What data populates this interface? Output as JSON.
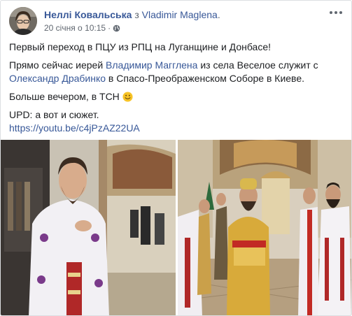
{
  "post": {
    "author": "Неллі Ковальська",
    "with_word": " з ",
    "tagged": "Vladimir Maglena",
    "tagged_suffix": ".",
    "timestamp": "20 січня о 10:15",
    "separator": " · ",
    "privacy_icon": "globe-icon",
    "menu_icon": "more-options-icon"
  },
  "body": {
    "line1": "Первый переход в ПЦУ из РПЦ на Луганщине и Донбасе!",
    "line2_prefix": "Прямо сейчас иерей ",
    "line2_link1": "Владимир Магглена",
    "line2_mid": " из села Веселое служит с ",
    "line2_link2": "Олександр Драбинко",
    "line2_suffix": " в Спасо-Преображенском Соборе в Киеве.",
    "line3": "Больше вечером, в ТСН ",
    "line3_emoji": "smile-emoji",
    "line4": "UPD: а вот и сюжет.",
    "link_url": "https://youtu.be/c4jPzAZ22UA"
  },
  "photos": [
    {
      "name": "priest-portrait-photo"
    },
    {
      "name": "cathedral-service-photo"
    }
  ],
  "colors": {
    "link": "#385898",
    "text": "#1c1e21",
    "meta": "#606770"
  }
}
